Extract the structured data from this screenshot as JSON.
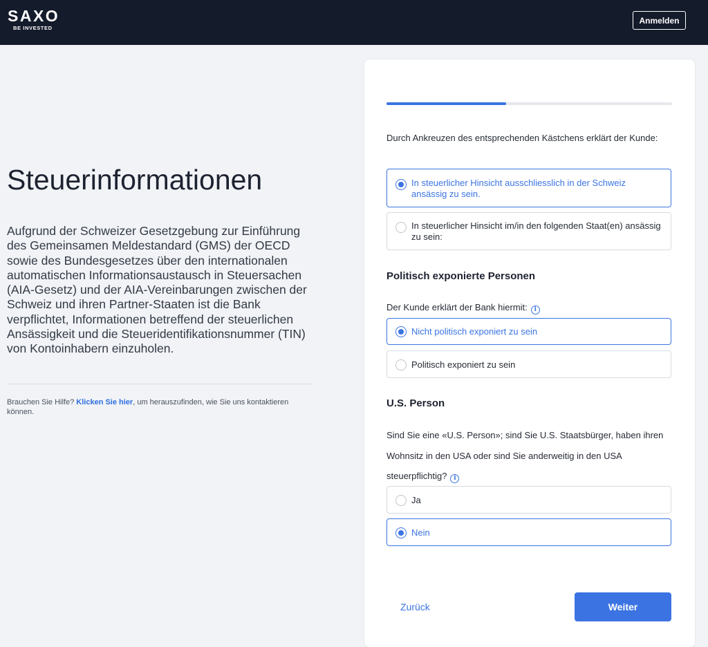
{
  "header": {
    "logo_main": "SAXO",
    "logo_sub": "BE INVESTED",
    "login_label": "Anmelden"
  },
  "left": {
    "title": "Steuerinformationen",
    "intro": "Aufgrund der Schweizer Gesetzgebung zur Einführung des Gemeinsamen Meldestandard (GMS) der OECD sowie des Bundesgesetzes über den internationalen automatischen Informationsaustausch in Steuersachen (AIA-Gesetz) und der AIA-Vereinbarungen zwischen der Schweiz und ihren Partner-Staaten ist die Bank verpflichtet, Informationen betreffend der steuerlichen Ansässigkeit und die Steueridentifikationsnummer (TIN) von Kontoinhabern einzuholen.",
    "help_prefix": "Brauchen Sie Hilfe? ",
    "help_link": "Klicken Sie hier",
    "help_suffix": ", um herauszufinden, wie Sie uns kontaktieren können."
  },
  "progress": {
    "fraction": 0.42
  },
  "tax_residency": {
    "question": "Durch Ankreuzen des entsprechenden Kästchens erklärt der Kunde:",
    "options": [
      {
        "label": "In steuerlicher Hinsicht ausschliesslich in der Schweiz ansässig zu sein.",
        "selected": true
      },
      {
        "label": "In steuerlicher Hinsicht im/in den folgenden Staat(en) ansässig zu sein:",
        "selected": false
      }
    ]
  },
  "pep": {
    "title": "Politisch exponierte Personen",
    "question": "Der Kunde erklärt der Bank hiermit:",
    "options": [
      {
        "label": "Nicht politisch exponiert zu sein",
        "selected": true
      },
      {
        "label": "Politisch exponiert zu sein",
        "selected": false
      }
    ]
  },
  "us_person": {
    "title": "U.S. Person",
    "question": "Sind Sie eine «U.S. Person»; sind Sie U.S. Staatsbürger, haben ihren Wohnsitz in den USA oder sind Sie anderweitig in den USA steuerpflichtig?",
    "options": [
      {
        "label": "Ja",
        "selected": false
      },
      {
        "label": "Nein",
        "selected": true
      }
    ]
  },
  "icons": {
    "info": "info-icon",
    "radio": "radio-icon"
  },
  "info_glyph": "i",
  "footer": {
    "back_label": "Zurück",
    "next_label": "Weiter"
  },
  "colors": {
    "accent": "#3b74e2",
    "header_bg": "#141b2b",
    "page_bg": "#f1f3f6"
  }
}
